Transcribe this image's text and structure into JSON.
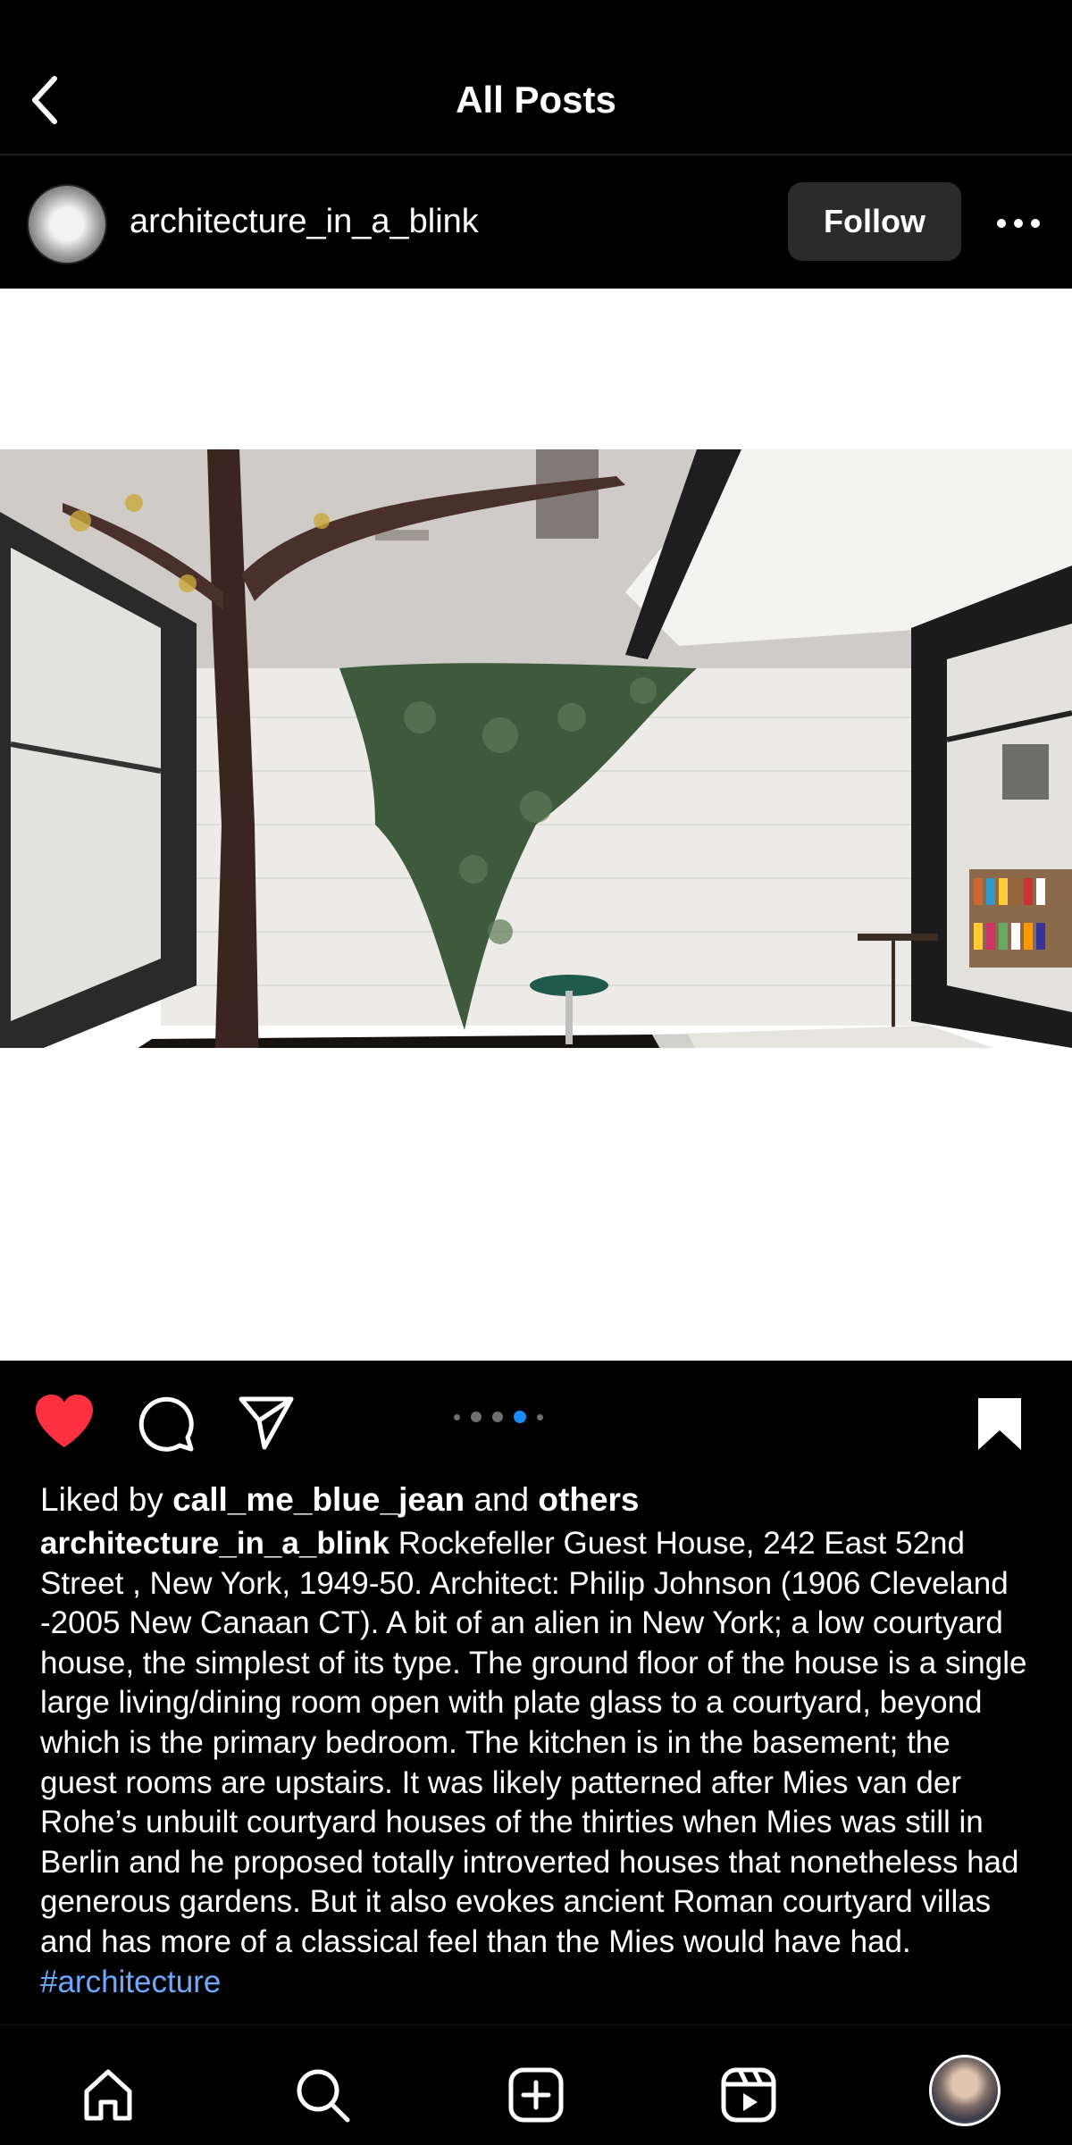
{
  "header": {
    "title": "All Posts",
    "back_icon": "chevron-left-icon"
  },
  "post": {
    "username": "architecture_in_a_blink",
    "follow_label": "Follow",
    "more_icon": "ellipsis-icon",
    "carousel": {
      "count": 5,
      "active_index": 3
    },
    "actions": {
      "like_icon": "heart-icon",
      "like_color": "#ff3040",
      "comment_icon": "comment-icon",
      "share_icon": "send-icon",
      "save_icon": "bookmark-icon"
    },
    "liked_by": {
      "prefix": "Liked by ",
      "user": "call_me_blue_jean",
      "middle": " and ",
      "others": "others"
    },
    "caption": {
      "author": "architecture_in_a_blink",
      "text": " Rockefeller Guest House, 242 East 52nd Street , New York, 1949-50. Architect: Philip Johnson (1906 Cleveland -2005 New Canaan CT). A bit of an alien in New York; a low courtyard house, the simplest of its type. The ground floor of the house is a single large living/dining room open with plate glass to a courtyard, beyond which is the primary bedroom. The kitchen is in the basement; the guest rooms are upstairs. It was likely patterned after Mies van der Rohe’s unbuilt courtyard houses of the thirties when Mies was still in Berlin and he proposed totally introverted houses that nonetheless had generous gardens. But it also evokes ancient Roman courtyard villas and has more of a classical feel than the Mies would have had. ",
      "hashtag": "#architecture",
      "hashtag_color": "#6ea8ff"
    }
  },
  "nav": {
    "items": [
      "home-icon",
      "search-icon",
      "create-icon",
      "reels-icon",
      "profile-avatar"
    ]
  }
}
